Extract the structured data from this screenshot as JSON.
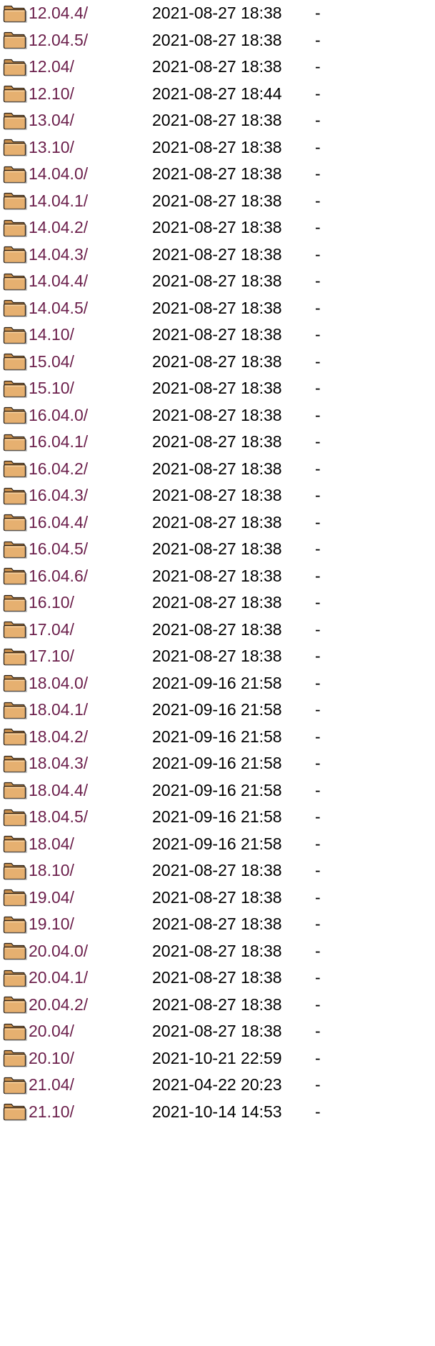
{
  "listing": {
    "folder_icon": "folder-icon",
    "link_color": "#6b1f4b",
    "rows": [
      {
        "name": "12.04.4/",
        "modified": "2021-08-27 18:38",
        "size": "-"
      },
      {
        "name": "12.04.5/",
        "modified": "2021-08-27 18:38",
        "size": "-"
      },
      {
        "name": "12.04/",
        "modified": "2021-08-27 18:38",
        "size": "-"
      },
      {
        "name": "12.10/",
        "modified": "2021-08-27 18:44",
        "size": "-"
      },
      {
        "name": "13.04/",
        "modified": "2021-08-27 18:38",
        "size": "-"
      },
      {
        "name": "13.10/",
        "modified": "2021-08-27 18:38",
        "size": "-"
      },
      {
        "name": "14.04.0/",
        "modified": "2021-08-27 18:38",
        "size": "-"
      },
      {
        "name": "14.04.1/",
        "modified": "2021-08-27 18:38",
        "size": "-"
      },
      {
        "name": "14.04.2/",
        "modified": "2021-08-27 18:38",
        "size": "-"
      },
      {
        "name": "14.04.3/",
        "modified": "2021-08-27 18:38",
        "size": "-"
      },
      {
        "name": "14.04.4/",
        "modified": "2021-08-27 18:38",
        "size": "-"
      },
      {
        "name": "14.04.5/",
        "modified": "2021-08-27 18:38",
        "size": "-"
      },
      {
        "name": "14.10/",
        "modified": "2021-08-27 18:38",
        "size": "-"
      },
      {
        "name": "15.04/",
        "modified": "2021-08-27 18:38",
        "size": "-"
      },
      {
        "name": "15.10/",
        "modified": "2021-08-27 18:38",
        "size": "-"
      },
      {
        "name": "16.04.0/",
        "modified": "2021-08-27 18:38",
        "size": "-"
      },
      {
        "name": "16.04.1/",
        "modified": "2021-08-27 18:38",
        "size": "-"
      },
      {
        "name": "16.04.2/",
        "modified": "2021-08-27 18:38",
        "size": "-"
      },
      {
        "name": "16.04.3/",
        "modified": "2021-08-27 18:38",
        "size": "-"
      },
      {
        "name": "16.04.4/",
        "modified": "2021-08-27 18:38",
        "size": "-"
      },
      {
        "name": "16.04.5/",
        "modified": "2021-08-27 18:38",
        "size": "-"
      },
      {
        "name": "16.04.6/",
        "modified": "2021-08-27 18:38",
        "size": "-"
      },
      {
        "name": "16.10/",
        "modified": "2021-08-27 18:38",
        "size": "-"
      },
      {
        "name": "17.04/",
        "modified": "2021-08-27 18:38",
        "size": "-"
      },
      {
        "name": "17.10/",
        "modified": "2021-08-27 18:38",
        "size": "-"
      },
      {
        "name": "18.04.0/",
        "modified": "2021-09-16 21:58",
        "size": "-"
      },
      {
        "name": "18.04.1/",
        "modified": "2021-09-16 21:58",
        "size": "-"
      },
      {
        "name": "18.04.2/",
        "modified": "2021-09-16 21:58",
        "size": "-"
      },
      {
        "name": "18.04.3/",
        "modified": "2021-09-16 21:58",
        "size": "-"
      },
      {
        "name": "18.04.4/",
        "modified": "2021-09-16 21:58",
        "size": "-"
      },
      {
        "name": "18.04.5/",
        "modified": "2021-09-16 21:58",
        "size": "-"
      },
      {
        "name": "18.04/",
        "modified": "2021-09-16 21:58",
        "size": "-"
      },
      {
        "name": "18.10/",
        "modified": "2021-08-27 18:38",
        "size": "-"
      },
      {
        "name": "19.04/",
        "modified": "2021-08-27 18:38",
        "size": "-"
      },
      {
        "name": "19.10/",
        "modified": "2021-08-27 18:38",
        "size": "-"
      },
      {
        "name": "20.04.0/",
        "modified": "2021-08-27 18:38",
        "size": "-"
      },
      {
        "name": "20.04.1/",
        "modified": "2021-08-27 18:38",
        "size": "-"
      },
      {
        "name": "20.04.2/",
        "modified": "2021-08-27 18:38",
        "size": "-"
      },
      {
        "name": "20.04/",
        "modified": "2021-08-27 18:38",
        "size": "-"
      },
      {
        "name": "20.10/",
        "modified": "2021-10-21 22:59",
        "size": "-"
      },
      {
        "name": "21.04/",
        "modified": "2021-04-22 20:23",
        "size": "-"
      },
      {
        "name": "21.10/",
        "modified": "2021-10-14 14:53",
        "size": "-"
      }
    ]
  }
}
